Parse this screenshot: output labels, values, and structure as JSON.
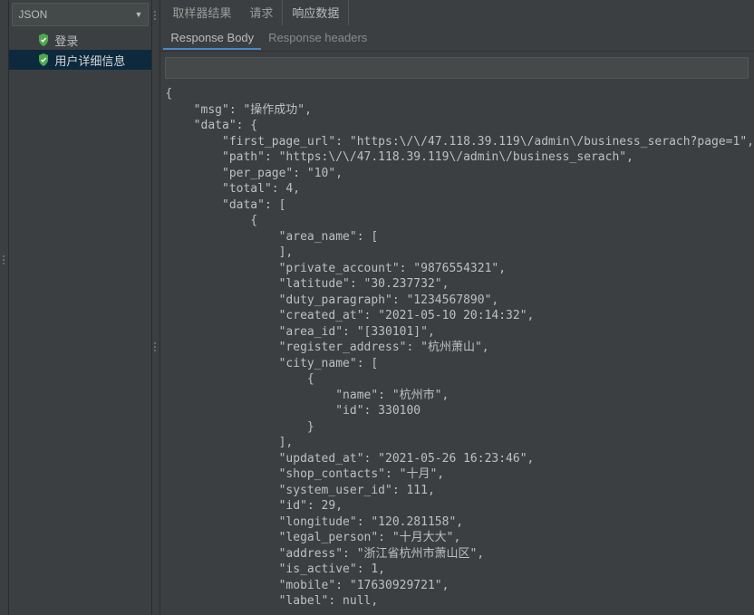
{
  "sidebar": {
    "format_label": "JSON",
    "items": [
      {
        "label": "登录"
      },
      {
        "label": "用户详细信息"
      }
    ]
  },
  "tabs": {
    "top": [
      {
        "label": "取样器结果"
      },
      {
        "label": "请求"
      },
      {
        "label": "响应数据"
      }
    ],
    "sub": [
      {
        "label": "Response Body"
      },
      {
        "label": "Response headers"
      }
    ]
  },
  "response_body_lines": [
    "{",
    "    \"msg\": \"操作成功\",",
    "    \"data\": {",
    "        \"first_page_url\": \"https:\\/\\/47.118.39.119\\/admin\\/business_serach?page=1\",",
    "        \"path\": \"https:\\/\\/47.118.39.119\\/admin\\/business_serach\",",
    "        \"per_page\": \"10\",",
    "        \"total\": 4,",
    "        \"data\": [",
    "            {",
    "                \"area_name\": [",
    "                ],",
    "                \"private_account\": \"9876554321\",",
    "                \"latitude\": \"30.237732\",",
    "                \"duty_paragraph\": \"1234567890\",",
    "                \"created_at\": \"2021-05-10 20:14:32\",",
    "                \"area_id\": \"[330101]\",",
    "                \"register_address\": \"杭州萧山\",",
    "                \"city_name\": [",
    "                    {",
    "                        \"name\": \"杭州市\",",
    "                        \"id\": 330100",
    "                    }",
    "                ],",
    "                \"updated_at\": \"2021-05-26 16:23:46\",",
    "                \"shop_contacts\": \"十月\",",
    "                \"system_user_id\": 111,",
    "                \"id\": 29,",
    "                \"longitude\": \"120.281158\",",
    "                \"legal_person\": \"十月大大\",",
    "                \"address\": \"浙江省杭州市萧山区\",",
    "                \"is_active\": 1,",
    "                \"mobile\": \"17630929721\",",
    "                \"label\": null,"
  ]
}
